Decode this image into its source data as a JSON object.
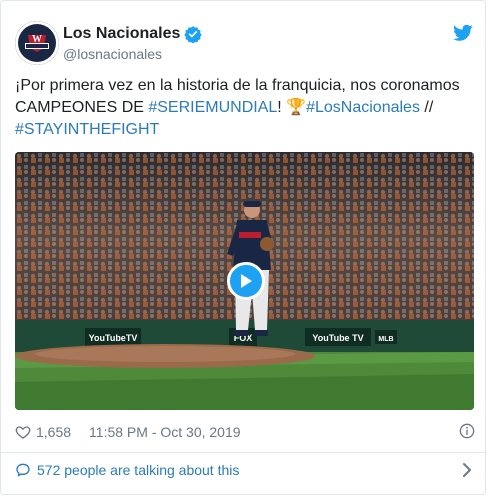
{
  "author": {
    "display_name": "Los Nacionales",
    "handle": "@losnacionales",
    "avatar_icon": "nationals-champions-logo",
    "verified_icon": "verified-badge-icon"
  },
  "tweet": {
    "parts": [
      {
        "text": "¡Por primera vez en la historia de la franquicia, nos coronamos CAMPEONES DE ",
        "link": false
      },
      {
        "text": "#SERIEMUNDIAL",
        "link": true
      },
      {
        "text": "! ",
        "link": false
      },
      {
        "text": "🏆",
        "link": false
      },
      {
        "text": "#LosNacionales",
        "link": true
      },
      {
        "text": " // ",
        "link": false
      },
      {
        "text": "#STAYINTHEFIGHT",
        "link": true
      }
    ]
  },
  "media": {
    "type": "video",
    "play_icon": "play-icon",
    "ads": [
      "YouTubeTV",
      "YouTube TV",
      "MLB",
      "FOX"
    ]
  },
  "meta": {
    "likes": "1,658",
    "timestamp": "11:58 PM - Oct 30, 2019"
  },
  "footer": {
    "talking_text": "572 people are talking about this"
  },
  "colors": {
    "link": "#2b7bb9",
    "twitter_blue": "#1da1f2",
    "muted": "#697882"
  }
}
